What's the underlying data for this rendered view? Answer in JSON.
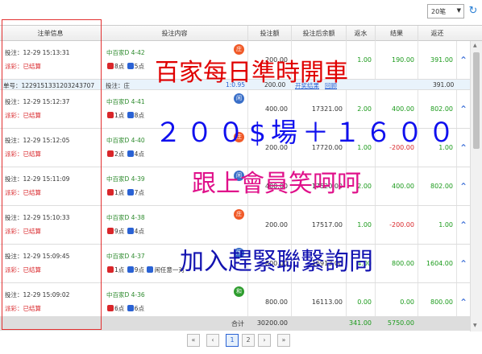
{
  "toolbar": {
    "page_size": "20笔"
  },
  "columns": [
    "注单信息",
    "投注内容",
    "投注额",
    "投注后余额",
    "返水",
    "结果",
    "返还"
  ],
  "rows": [
    {
      "kind": "bet",
      "time": "投注：12-29 15:13:31",
      "status": "派彩：已结算",
      "game": "中百家D 4-42",
      "r1": "8点",
      "r1c": "red",
      "r2": "5点",
      "r2c": "blue",
      "extra": "",
      "badge": "庄",
      "badge_type": "zhuang",
      "amount": "200.00",
      "balance": "",
      "rebate": "1.00",
      "result": "190.00",
      "result_color": "green",
      "ret": "391.00",
      "ret_color": "green"
    },
    {
      "kind": "summary",
      "order": "单号：12291513312032437​07",
      "bet": "投注：庄",
      "odds": "1:0.95",
      "amount": "200.00",
      "open_label": "开奖结果",
      "replay_label": "回顾",
      "ret": "391.00"
    },
    {
      "kind": "bet",
      "time": "投注：12-29 15:12:37",
      "status": "派彩：已结算",
      "game": "中百家D 4-41",
      "r1": "1点",
      "r1c": "red",
      "r2": "8点",
      "r2c": "blue",
      "extra": "",
      "badge": "闲",
      "badge_type": "xian",
      "amount": "400.00",
      "balance": "17321.00",
      "rebate": "2.00",
      "result": "400.00",
      "result_color": "green",
      "ret": "802.00",
      "ret_color": "green"
    },
    {
      "kind": "bet",
      "time": "投注：12-29 15:12:05",
      "status": "派彩：已结算",
      "game": "中百家D 4-40",
      "r1": "2点",
      "r1c": "red",
      "r2": "4点",
      "r2c": "blue",
      "extra": "",
      "badge": "庄",
      "badge_type": "zhuang",
      "amount": "200.00",
      "balance": "17720.00",
      "rebate": "1.00",
      "result": "-200.00",
      "result_color": "red",
      "ret": "1.00",
      "ret_color": "green"
    },
    {
      "kind": "bet",
      "time": "投注：12-29 15:11:09",
      "status": "派彩：已结算",
      "game": "中百家D 4-39",
      "r1": "1点",
      "r1c": "red",
      "r2": "7点",
      "r2c": "blue",
      "extra": "",
      "badge": "闲",
      "badge_type": "xian",
      "amount": "400.00",
      "balance": "17520.00",
      "rebate": "2.00",
      "result": "400.00",
      "result_color": "green",
      "ret": "802.00",
      "ret_color": "green"
    },
    {
      "kind": "bet",
      "time": "投注：12-29 15:10:33",
      "status": "派彩：已结算",
      "game": "中百家D 4-38",
      "r1": "9点",
      "r1c": "red",
      "r2": "4点",
      "r2c": "blue",
      "extra": "",
      "badge": "庄",
      "badge_type": "zhuang",
      "amount": "200.00",
      "balance": "17517.00",
      "rebate": "1.00",
      "result": "-200.00",
      "result_color": "red",
      "ret": "1.00",
      "ret_color": "green"
    },
    {
      "kind": "bet",
      "time": "投注：12-29 15:09:45",
      "status": "派彩：已结算",
      "game": "中百家D 4-37",
      "r1": "1点",
      "r1c": "red",
      "r2": "9点",
      "r2c": "blue",
      "extra": "闲任意一对",
      "badge": "闲",
      "badge_type": "xian",
      "amount": "800.00",
      "balance": "16913.00",
      "rebate": "4.00",
      "result": "800.00",
      "result_color": "green",
      "ret": "1604.00",
      "ret_color": "green"
    },
    {
      "kind": "bet",
      "time": "投注：12-29 15:09:02",
      "status": "派彩：已结算",
      "game": "中百家D 4-36",
      "r1": "6点",
      "r1c": "red",
      "r2": "6点",
      "r2c": "blue",
      "extra": "",
      "badge": "和",
      "badge_type": "he",
      "amount": "800.00",
      "balance": "16113.00",
      "rebate": "0.00",
      "result": "0.00",
      "result_color": "green",
      "ret": "800.00",
      "ret_color": "green"
    }
  ],
  "totals": {
    "label": "合计",
    "amount": "30200.00",
    "rebate": "341.00",
    "result": "5750.00"
  },
  "pager": {
    "first": "«",
    "prev": "‹",
    "page1": "1",
    "page2": "2",
    "next": "›",
    "last": "»"
  },
  "overlay": {
    "line1": "百家每日準時開車",
    "line2": "２００$場＋１６００",
    "line3": "跟上會員笑呵呵",
    "line4": "加入趕緊聯繫詢問"
  }
}
